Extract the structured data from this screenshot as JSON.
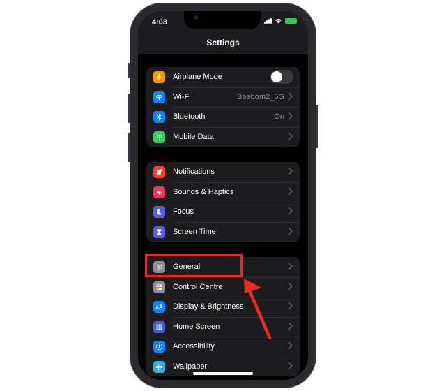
{
  "status": {
    "time": "4:03"
  },
  "header": {
    "title": "Settings"
  },
  "groups": [
    {
      "items": [
        {
          "label": "Airplane Mode",
          "icon": "airplane-icon",
          "icon_color": "#ff9500",
          "control": "toggle",
          "toggle_on": false
        },
        {
          "label": "Wi-Fi",
          "icon": "wifi-icon",
          "icon_color": "#0a84ff",
          "value": "Beebom2_5G"
        },
        {
          "label": "Bluetooth",
          "icon": "bluetooth-icon",
          "icon_color": "#0a84ff",
          "value": "On"
        },
        {
          "label": "Mobile Data",
          "icon": "antenna-icon",
          "icon_color": "#30d158"
        }
      ]
    },
    {
      "items": [
        {
          "label": "Notifications",
          "icon": "notifications-icon",
          "icon_color": "#ff3b30"
        },
        {
          "label": "Sounds & Haptics",
          "icon": "speaker-icon",
          "icon_color": "#ff2d55"
        },
        {
          "label": "Focus",
          "icon": "moon-icon",
          "icon_color": "#5e5ce6"
        },
        {
          "label": "Screen Time",
          "icon": "hourglass-icon",
          "icon_color": "#5e5ce6"
        }
      ]
    },
    {
      "items": [
        {
          "label": "General",
          "icon": "gear-icon",
          "icon_color": "#8e8e93"
        },
        {
          "label": "Control Centre",
          "icon": "switches-icon",
          "icon_color": "#8e8e93"
        },
        {
          "label": "Display & Brightness",
          "icon": "text-size-icon",
          "icon_color": "#0a84ff"
        },
        {
          "label": "Home Screen",
          "icon": "grid-icon",
          "icon_color": "#3a5fe5"
        },
        {
          "label": "Accessibility",
          "icon": "accessibility-icon",
          "icon_color": "#0a84ff"
        },
        {
          "label": "Wallpaper",
          "icon": "flower-icon",
          "icon_color": "#32ade6"
        }
      ]
    }
  ],
  "colors": {
    "highlight": "#ec2a20",
    "background": "#000000",
    "group_background": "#1c1c1e"
  }
}
